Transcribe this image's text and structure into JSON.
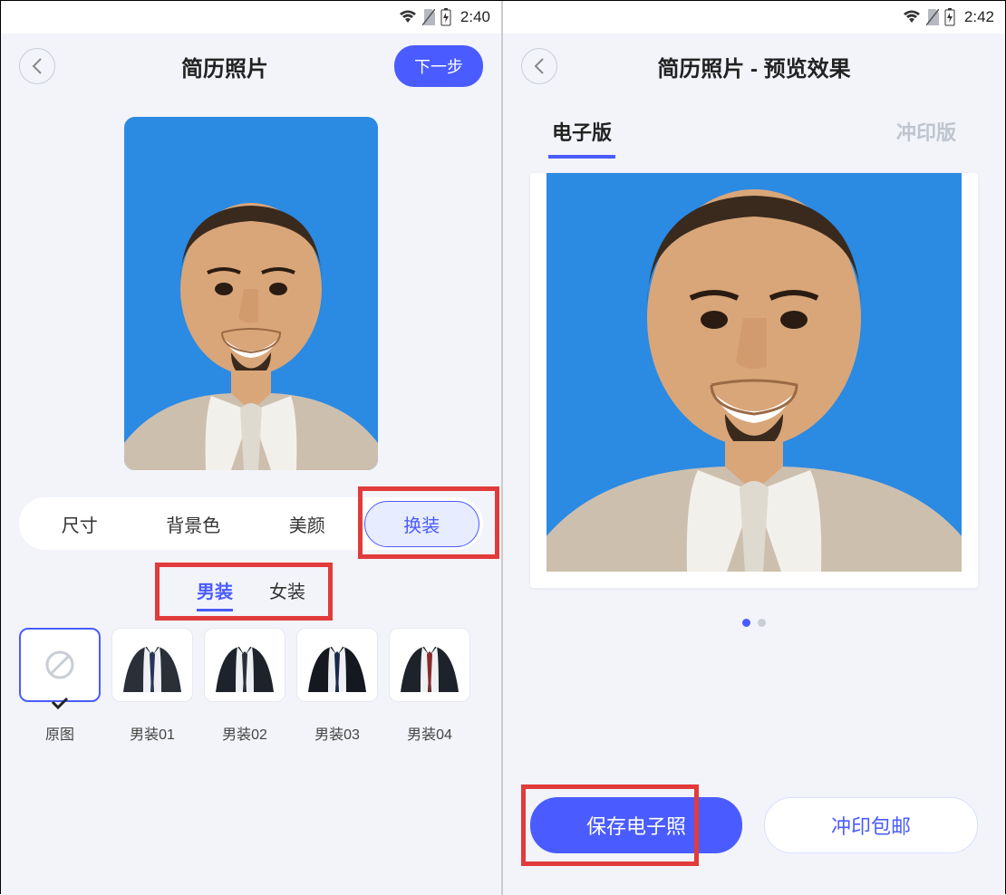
{
  "statusbar": {
    "time1": "2:40",
    "time2": "2:42"
  },
  "screen1": {
    "title": "简历照片",
    "next": "下一步",
    "options": [
      "尺寸",
      "背景色",
      "美颜",
      "换装"
    ],
    "option_active_index": 3,
    "sub_tabs": [
      "男装",
      "女装"
    ],
    "sub_active_index": 0,
    "outfits": [
      "原图",
      "男装01",
      "男装02",
      "男装03",
      "男装04"
    ],
    "outfit_selected_index": 0
  },
  "screen2": {
    "title": "简历照片 - 预览效果",
    "tabs": [
      "电子版",
      "冲印版"
    ],
    "tab_active_index": 0,
    "dot_count": 2,
    "dot_active_index": 0,
    "save_btn": "保存电子照",
    "print_btn": "冲印包邮"
  }
}
